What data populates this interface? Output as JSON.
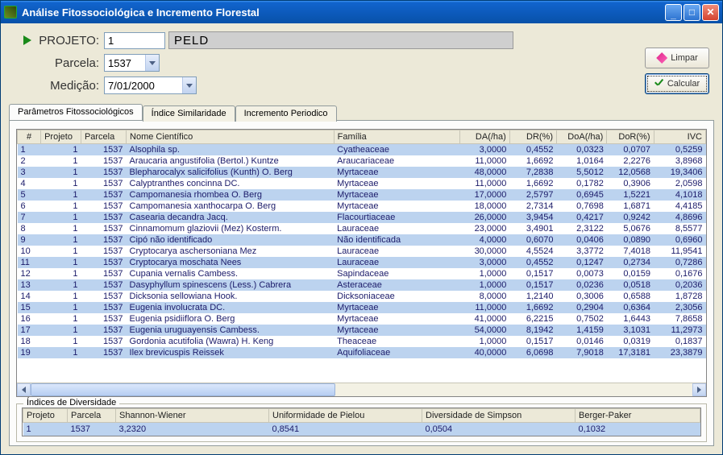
{
  "window": {
    "title": "Análise Fitossociológica e Incremento Florestal"
  },
  "form": {
    "projeto_label": "PROJETO:",
    "projeto_value": "1",
    "projeto_name": "PELD",
    "parcela_label": "Parcela:",
    "parcela_value": "1537",
    "medicao_label": "Medição:",
    "medicao_value": "7/01/2000"
  },
  "buttons": {
    "limpar": "Limpar",
    "calcular": "Calcular"
  },
  "tabs": {
    "t1": "Parâmetros Fitossociológicos",
    "t2": "Índice Similaridade",
    "t3": "Incremento Periodico"
  },
  "grid": {
    "headers": {
      "idx": "#",
      "projeto": "Projeto",
      "parcela": "Parcela",
      "nome": "Nome Científico",
      "familia": "Família",
      "da": "DA(/ha)",
      "dr": "DR(%)",
      "doa": "DoA(/ha)",
      "dor": "DoR(%)",
      "ivc": "IVC"
    },
    "rows": [
      {
        "i": "1",
        "pj": "1",
        "pc": "1537",
        "nome": "Alsophila sp.",
        "fam": "Cyatheaceae",
        "da": "3,0000",
        "dr": "0,4552",
        "doa": "0,0323",
        "dor": "0,0707",
        "ivc": "0,5259"
      },
      {
        "i": "2",
        "pj": "1",
        "pc": "1537",
        "nome": "Araucaria angustifolia (Bertol.) Kuntze",
        "fam": "Araucariaceae",
        "da": "11,0000",
        "dr": "1,6692",
        "doa": "1,0164",
        "dor": "2,2276",
        "ivc": "3,8968"
      },
      {
        "i": "3",
        "pj": "1",
        "pc": "1537",
        "nome": "Blepharocalyx salicifolius (Kunth) O. Berg",
        "fam": "Myrtaceae",
        "da": "48,0000",
        "dr": "7,2838",
        "doa": "5,5012",
        "dor": "12,0568",
        "ivc": "19,3406"
      },
      {
        "i": "4",
        "pj": "1",
        "pc": "1537",
        "nome": "Calyptranthes concinna DC.",
        "fam": "Myrtaceae",
        "da": "11,0000",
        "dr": "1,6692",
        "doa": "0,1782",
        "dor": "0,3906",
        "ivc": "2,0598"
      },
      {
        "i": "5",
        "pj": "1",
        "pc": "1537",
        "nome": "Campomanesia rhombea O. Berg",
        "fam": "Myrtaceae",
        "da": "17,0000",
        "dr": "2,5797",
        "doa": "0,6945",
        "dor": "1,5221",
        "ivc": "4,1018"
      },
      {
        "i": "6",
        "pj": "1",
        "pc": "1537",
        "nome": "Campomanesia xanthocarpa O. Berg",
        "fam": "Myrtaceae",
        "da": "18,0000",
        "dr": "2,7314",
        "doa": "0,7698",
        "dor": "1,6871",
        "ivc": "4,4185"
      },
      {
        "i": "7",
        "pj": "1",
        "pc": "1537",
        "nome": "Casearia decandra Jacq.",
        "fam": "Flacourtiaceae",
        "da": "26,0000",
        "dr": "3,9454",
        "doa": "0,4217",
        "dor": "0,9242",
        "ivc": "4,8696"
      },
      {
        "i": "8",
        "pj": "1",
        "pc": "1537",
        "nome": "Cinnamomum glaziovii (Mez) Kosterm.",
        "fam": "Lauraceae",
        "da": "23,0000",
        "dr": "3,4901",
        "doa": "2,3122",
        "dor": "5,0676",
        "ivc": "8,5577"
      },
      {
        "i": "9",
        "pj": "1",
        "pc": "1537",
        "nome": "Cipó não identificado",
        "fam": "Não identificada",
        "da": "4,0000",
        "dr": "0,6070",
        "doa": "0,0406",
        "dor": "0,0890",
        "ivc": "0,6960"
      },
      {
        "i": "10",
        "pj": "1",
        "pc": "1537",
        "nome": "Cryptocarya aschersoniana Mez",
        "fam": "Lauraceae",
        "da": "30,0000",
        "dr": "4,5524",
        "doa": "3,3772",
        "dor": "7,4018",
        "ivc": "11,9541"
      },
      {
        "i": "11",
        "pj": "1",
        "pc": "1537",
        "nome": "Cryptocarya moschata Nees",
        "fam": "Lauraceae",
        "da": "3,0000",
        "dr": "0,4552",
        "doa": "0,1247",
        "dor": "0,2734",
        "ivc": "0,7286"
      },
      {
        "i": "12",
        "pj": "1",
        "pc": "1537",
        "nome": "Cupania vernalis Cambess.",
        "fam": "Sapindaceae",
        "da": "1,0000",
        "dr": "0,1517",
        "doa": "0,0073",
        "dor": "0,0159",
        "ivc": "0,1676"
      },
      {
        "i": "13",
        "pj": "1",
        "pc": "1537",
        "nome": "Dasyphyllum spinescens (Less.) Cabrera",
        "fam": "Asteraceae",
        "da": "1,0000",
        "dr": "0,1517",
        "doa": "0,0236",
        "dor": "0,0518",
        "ivc": "0,2036"
      },
      {
        "i": "14",
        "pj": "1",
        "pc": "1537",
        "nome": "Dicksonia sellowiana Hook.",
        "fam": "Dicksoniaceae",
        "da": "8,0000",
        "dr": "1,2140",
        "doa": "0,3006",
        "dor": "0,6588",
        "ivc": "1,8728"
      },
      {
        "i": "15",
        "pj": "1",
        "pc": "1537",
        "nome": "Eugenia involucrata DC.",
        "fam": "Myrtaceae",
        "da": "11,0000",
        "dr": "1,6692",
        "doa": "0,2904",
        "dor": "0,6364",
        "ivc": "2,3056"
      },
      {
        "i": "16",
        "pj": "1",
        "pc": "1537",
        "nome": "Eugenia psidiiflora O. Berg",
        "fam": "Myrtaceae",
        "da": "41,0000",
        "dr": "6,2215",
        "doa": "0,7502",
        "dor": "1,6443",
        "ivc": "7,8658"
      },
      {
        "i": "17",
        "pj": "1",
        "pc": "1537",
        "nome": "Eugenia uruguayensis Cambess.",
        "fam": "Myrtaceae",
        "da": "54,0000",
        "dr": "8,1942",
        "doa": "1,4159",
        "dor": "3,1031",
        "ivc": "11,2973"
      },
      {
        "i": "18",
        "pj": "1",
        "pc": "1537",
        "nome": "Gordonia acutifolia (Wawra) H. Keng",
        "fam": "Theaceae",
        "da": "1,0000",
        "dr": "0,1517",
        "doa": "0,0146",
        "dor": "0,0319",
        "ivc": "0,1837"
      },
      {
        "i": "19",
        "pj": "1",
        "pc": "1537",
        "nome": "Ilex brevicuspis Reissek",
        "fam": "Aquifoliaceae",
        "da": "40,0000",
        "dr": "6,0698",
        "doa": "7,9018",
        "dor": "17,3181",
        "ivc": "23,3879"
      }
    ]
  },
  "diversity": {
    "legend": "Índices de Diversidade",
    "headers": {
      "projeto": "Projeto",
      "parcela": "Parcela",
      "shannon": "Shannon-Wiener",
      "pielou": "Uniformidade de Pielou",
      "simpson": "Diversidade de Simpson",
      "berger": "Berger-Paker"
    },
    "row": {
      "projeto": "1",
      "parcela": "1537",
      "shannon": "3,2320",
      "pielou": "0,8541",
      "simpson": "0,0504",
      "berger": "0,1032"
    }
  }
}
